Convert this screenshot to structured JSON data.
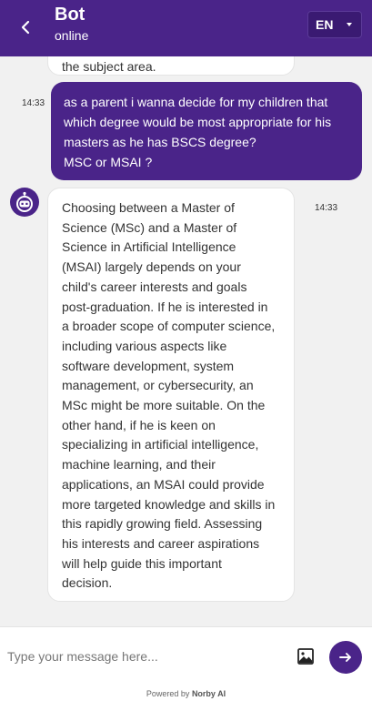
{
  "header": {
    "bot_name": "Bot",
    "status": "online",
    "language": "EN",
    "back_icon": "chevron-left-icon",
    "colors": {
      "brand": "#4a2489"
    }
  },
  "messages": {
    "previous_fragment": "the subject area.",
    "user": {
      "time": "14:33",
      "lines": [
        "as a parent i wanna decide for my children that",
        "which degree would be most appropriate for his",
        "masters as he has BSCS degree?",
        "MSC or MSAI ?"
      ]
    },
    "bot": {
      "time": "14:33",
      "avatar_icon": "robot-icon",
      "lines": [
        "Choosing between a Master of",
        "Science (MSc) and a Master of",
        "Science in Artificial Intelligence",
        "(MSAI) largely depends on your",
        "child's career interests and goals",
        "post-graduation. If he is interested in",
        "a broader scope of computer science,",
        "including various aspects like",
        "software development, system",
        "management, or cybersecurity, an",
        "MSc might be more suitable. On the",
        "other hand, if he is keen on",
        "specializing in artificial intelligence,",
        "machine learning, and their",
        "applications, an MSAI could provide",
        "more targeted knowledge and skills in",
        "this rapidly growing field. Assessing",
        "his interests and career aspirations",
        "will help guide this important",
        "decision."
      ]
    }
  },
  "composer": {
    "placeholder": "Type your message here...",
    "image_icon": "image-icon",
    "send_icon": "arrow-right-icon"
  },
  "footer": {
    "prefix": "Powered by",
    "brand": "Norby AI"
  }
}
